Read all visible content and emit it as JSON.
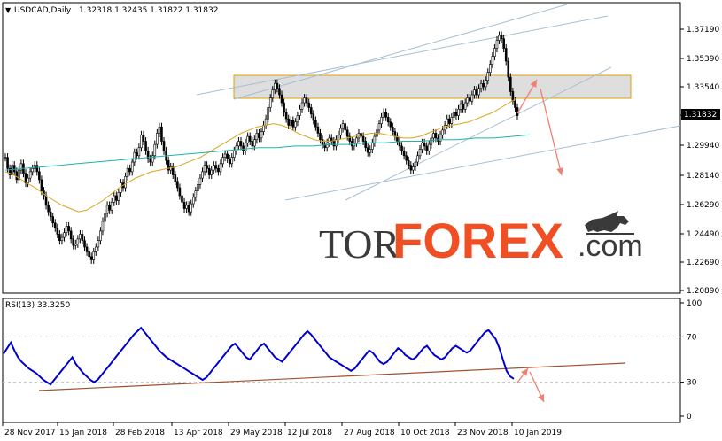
{
  "header": {
    "symbol": "USDCAD,Daily",
    "ohlc": "1.32318 1.32435 1.31822 1.31832"
  },
  "rsi_header": "RSI(13) 33.3250",
  "watermark": {
    "part1": "TOR",
    "part2": "FOREX",
    "part3": ".com"
  },
  "current_price": "1.31832",
  "colors": {
    "candle": "#000000",
    "ma_fast": "#daa520",
    "ma_slow": "#20b2aa",
    "rsi_line": "#0000cd",
    "rsi_trend": "#a0522d",
    "channel": "#a7bfd3",
    "zone_fill": "#d3d3d3",
    "zone_border": "#e0a000",
    "arrow": "#f08070",
    "watermark_dark": "#3a3a3a",
    "watermark_accent": "#f04e23"
  },
  "chart_data": [
    {
      "type": "candlestick",
      "title": "USDCAD,Daily",
      "x_tick_labels": [
        "28 Nov 2017",
        "15 Jan 2018",
        "28 Feb 2018",
        "13 Apr 2018",
        "29 May 2018",
        "12 Jul 2018",
        "27 Aug 2018",
        "10 Oct 2018",
        "23 Nov 2018",
        "10 Jan 2019"
      ],
      "y_tick_labels": [
        "1.37190",
        "1.35390",
        "1.33540",
        "1.31832",
        "1.29940",
        "1.28140",
        "1.26290",
        "1.24490",
        "1.22690",
        "1.20890"
      ],
      "ylim": [
        1.2089,
        1.3719
      ],
      "resistance_zone": [
        1.333,
        1.344
      ],
      "close_series": [
        1.292,
        1.285,
        1.281,
        1.287,
        1.283,
        1.278,
        1.284,
        1.288,
        1.282,
        1.276,
        1.279,
        1.283,
        1.285,
        1.287,
        1.283,
        1.278,
        1.271,
        1.268,
        1.262,
        1.258,
        1.255,
        1.251,
        1.248,
        1.244,
        1.24,
        1.242,
        1.245,
        1.249,
        1.246,
        1.241,
        1.237,
        1.238,
        1.241,
        1.244,
        1.24,
        1.236,
        1.233,
        1.23,
        1.228,
        1.233,
        1.236,
        1.24,
        1.246,
        1.252,
        1.257,
        1.262,
        1.259,
        1.264,
        1.268,
        1.265,
        1.27,
        1.276,
        1.273,
        1.28,
        1.285,
        1.283,
        1.289,
        1.295,
        1.293,
        1.298,
        1.306,
        1.302,
        1.296,
        1.291,
        1.289,
        1.293,
        1.3,
        1.307,
        1.311,
        1.302,
        1.296,
        1.29,
        1.284,
        1.286,
        1.281,
        1.277,
        1.273,
        1.268,
        1.264,
        1.26,
        1.262,
        1.258,
        1.263,
        1.267,
        1.271,
        1.275,
        1.279,
        1.283,
        1.287,
        1.285,
        1.281,
        1.284,
        1.287,
        1.285,
        1.283,
        1.288,
        1.292,
        1.294,
        1.291,
        1.288,
        1.292,
        1.296,
        1.299,
        1.302,
        1.299,
        1.296,
        1.301,
        1.305,
        1.302,
        1.299,
        1.303,
        1.307,
        1.304,
        1.308,
        1.312,
        1.316,
        1.323,
        1.329,
        1.334,
        1.338,
        1.335,
        1.331,
        1.326,
        1.32,
        1.316,
        1.312,
        1.315,
        1.311,
        1.314,
        1.318,
        1.322,
        1.326,
        1.329,
        1.326,
        1.323,
        1.319,
        1.315,
        1.311,
        1.307,
        1.303,
        1.3,
        1.298,
        1.301,
        1.304,
        1.302,
        1.299,
        1.303,
        1.306,
        1.31,
        1.313,
        1.309,
        1.305,
        1.302,
        1.299,
        1.301,
        1.304,
        1.307,
        1.305,
        1.302,
        1.298,
        1.295,
        1.297,
        1.301,
        1.305,
        1.309,
        1.313,
        1.317,
        1.32,
        1.317,
        1.314,
        1.311,
        1.308,
        1.305,
        1.302,
        1.299,
        1.296,
        1.293,
        1.29,
        1.287,
        1.284,
        1.286,
        1.289,
        1.293,
        1.297,
        1.301,
        1.299,
        1.296,
        1.3,
        1.304,
        1.307,
        1.304,
        1.302,
        1.306,
        1.309,
        1.312,
        1.316,
        1.313,
        1.317,
        1.32,
        1.318,
        1.322,
        1.325,
        1.322,
        1.326,
        1.329,
        1.327,
        1.331,
        1.334,
        1.331,
        1.335,
        1.338,
        1.336,
        1.34,
        1.345,
        1.35,
        1.355,
        1.36,
        1.365,
        1.368,
        1.366,
        1.36,
        1.352,
        1.342,
        1.333,
        1.327,
        1.323,
        1.318
      ],
      "ma_fast_series": [
        1.283,
        1.281,
        1.278,
        1.275,
        1.272,
        1.268,
        1.265,
        1.262,
        1.26,
        1.258,
        1.259,
        1.262,
        1.265,
        1.269,
        1.273,
        1.276,
        1.279,
        1.281,
        1.283,
        1.284,
        1.285,
        1.286,
        1.288,
        1.29,
        1.292,
        1.295,
        1.298,
        1.301,
        1.304,
        1.307,
        1.309,
        1.311,
        1.312,
        1.313,
        1.312,
        1.31,
        1.307,
        1.305,
        1.303,
        1.302,
        1.302,
        1.303,
        1.304,
        1.305,
        1.306,
        1.307,
        1.307,
        1.306,
        1.305,
        1.304,
        1.304,
        1.305,
        1.307,
        1.309,
        1.311,
        1.312,
        1.313,
        1.314,
        1.316,
        1.318,
        1.32,
        1.323,
        1.326,
        1.329
      ],
      "ma_slow_series": [
        1.284,
        1.285,
        1.286,
        1.287,
        1.288,
        1.289,
        1.29,
        1.291,
        1.292,
        1.293,
        1.294,
        1.295,
        1.296,
        1.297,
        1.298,
        1.298,
        1.299,
        1.299,
        1.3,
        1.3,
        1.301,
        1.301,
        1.302,
        1.302,
        1.303,
        1.303,
        1.304,
        1.304,
        1.305,
        1.306
      ],
      "rsi_ylim": [
        0,
        100
      ],
      "rsi_y_tick_labels": [
        "100",
        "70",
        "30",
        "0"
      ],
      "rsi_levels": [
        70,
        30
      ],
      "rsi_series": [
        55,
        60,
        65,
        58,
        52,
        48,
        45,
        42,
        40,
        38,
        35,
        32,
        30,
        28,
        32,
        36,
        40,
        44,
        48,
        52,
        46,
        42,
        38,
        35,
        32,
        30,
        32,
        36,
        40,
        44,
        48,
        52,
        56,
        60,
        64,
        68,
        72,
        75,
        78,
        74,
        70,
        66,
        62,
        58,
        55,
        52,
        50,
        48,
        46,
        44,
        42,
        40,
        38,
        36,
        34,
        32,
        34,
        38,
        42,
        46,
        50,
        54,
        58,
        62,
        64,
        60,
        56,
        52,
        50,
        54,
        58,
        62,
        64,
        60,
        56,
        52,
        50,
        48,
        52,
        56,
        60,
        64,
        68,
        72,
        75,
        72,
        68,
        64,
        60,
        56,
        52,
        50,
        48,
        46,
        44,
        42,
        40,
        42,
        46,
        50,
        54,
        58,
        56,
        52,
        48,
        46,
        48,
        52,
        56,
        60,
        58,
        54,
        52,
        50,
        52,
        56,
        60,
        62,
        58,
        54,
        52,
        50,
        52,
        56,
        60,
        62,
        60,
        58,
        56,
        58,
        62,
        66,
        70,
        74,
        76,
        72,
        68,
        60,
        50,
        40,
        35,
        33
      ]
    }
  ]
}
